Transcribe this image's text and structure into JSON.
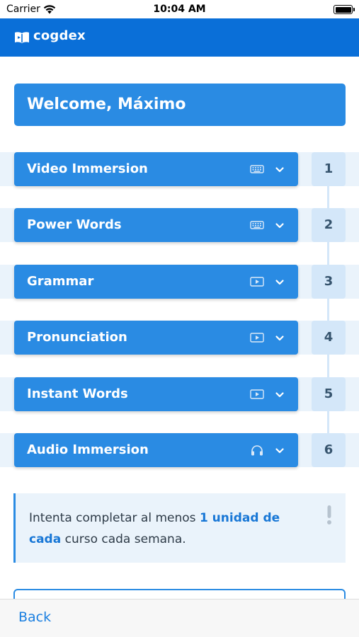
{
  "status_bar": {
    "carrier": "Carrier",
    "time": "10:04 AM",
    "battery_level": 1.0
  },
  "header": {
    "app_name": "cogdex",
    "brand_color": "#0a6fd8",
    "logo_icon": "book-logo-icon"
  },
  "welcome": {
    "text": "Welcome, Máximo"
  },
  "courses": [
    {
      "label": "Video Immersion",
      "icon": "keyboard-icon",
      "step": "1"
    },
    {
      "label": "Power Words",
      "icon": "keyboard-icon",
      "step": "2"
    },
    {
      "label": "Grammar",
      "icon": "video-play-icon",
      "step": "3"
    },
    {
      "label": "Pronunciation",
      "icon": "video-play-icon",
      "step": "4"
    },
    {
      "label": "Instant Words",
      "icon": "video-play-icon",
      "step": "5"
    },
    {
      "label": "Audio Immersion",
      "icon": "headphones-icon",
      "step": "6"
    }
  ],
  "tip": {
    "text_before": "Intenta completar al menos ",
    "highlight": "1 unidad de cada",
    "text_after": " curso cada semana.",
    "icon": "exclamation-icon"
  },
  "bottom_bar": {
    "back_label": "Back"
  },
  "colors": {
    "accent": "#2a8be3",
    "step_bg": "#d4e7f9",
    "band_bg": "#eaf3fb",
    "link": "#1a7fe0"
  }
}
